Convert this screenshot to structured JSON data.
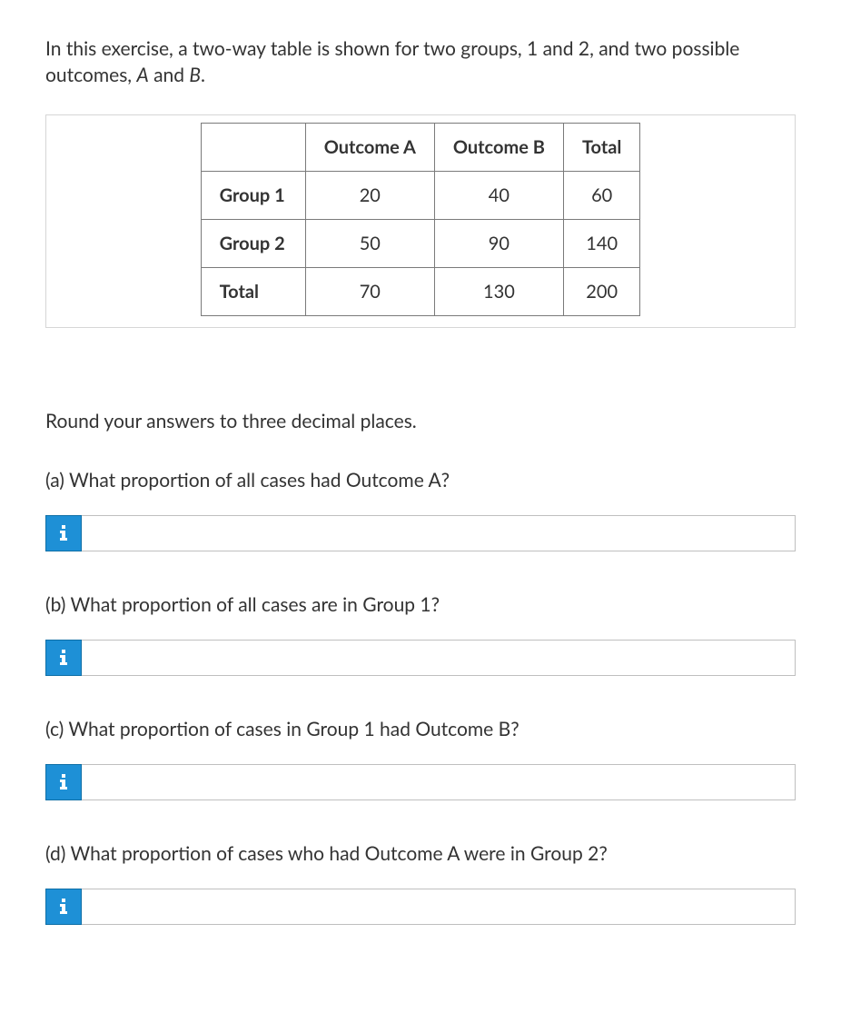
{
  "intro_prefix": "In this exercise, a two-way table is shown for two groups, 1 and 2, and two possible outcomes, ",
  "intro_em_a": "A",
  "intro_mid": " and ",
  "intro_em_b": "B",
  "intro_suffix": ".",
  "table": {
    "col_headers": [
      "Outcome A",
      "Outcome B",
      "Total"
    ],
    "rows": [
      {
        "label": "Group 1",
        "cells": [
          "20",
          "40",
          "60"
        ]
      },
      {
        "label": "Group 2",
        "cells": [
          "50",
          "90",
          "140"
        ]
      },
      {
        "label": "Total",
        "cells": [
          "70",
          "130",
          "200"
        ]
      }
    ]
  },
  "instructions": "Round your answers to three decimal places.",
  "questions": {
    "a": "(a) What proportion of all cases had Outcome A?",
    "b": "(b) What proportion of all cases are in Group 1?",
    "c": "(c) What proportion of cases in Group 1 had Outcome B?",
    "d": "(d) What proportion of cases who had Outcome A were in Group 2?"
  },
  "answers": {
    "a": "",
    "b": "",
    "c": "",
    "d": ""
  }
}
